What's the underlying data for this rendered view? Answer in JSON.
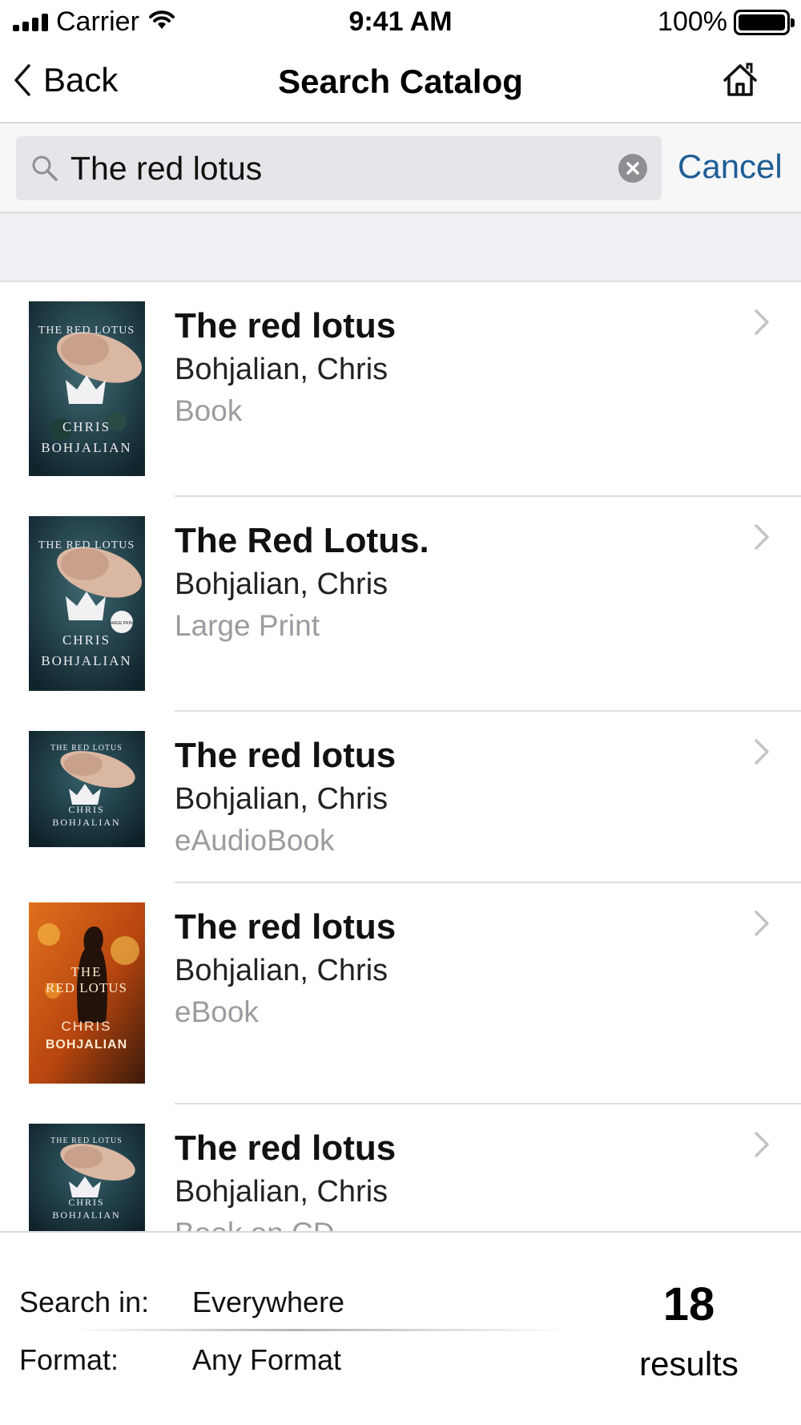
{
  "status_bar": {
    "carrier": "Carrier",
    "time": "9:41 AM",
    "battery": "100%"
  },
  "nav": {
    "back_label": "Back",
    "title": "Search Catalog",
    "home_icon": "home-icon"
  },
  "search": {
    "query": "The red lotus",
    "cancel_label": "Cancel"
  },
  "results": [
    {
      "title": "The red lotus",
      "author": "Bohjalian, Chris",
      "format": "Book"
    },
    {
      "title": "The Red Lotus.",
      "author": "Bohjalian, Chris",
      "format": "Large Print"
    },
    {
      "title": "The red lotus",
      "author": "Bohjalian, Chris",
      "format": "eAudioBook"
    },
    {
      "title": "The red lotus",
      "author": "Bohjalian, Chris",
      "format": "eBook"
    },
    {
      "title": "The red lotus",
      "author": "Bohjalian, Chris",
      "format": "Book on CD"
    }
  ],
  "covers": [
    {
      "top_text": "THE RED LOTUS",
      "author_first": "CHRIS",
      "author_last": "BOHJALIAN"
    },
    {
      "top_text": "THE RED LOTUS",
      "author_first": "CHRIS",
      "author_last": "BOHJALIAN",
      "badge": "LARGE PRINT"
    },
    {
      "top_text": "THE RED LOTUS",
      "author_first": "CHRIS",
      "author_last": "BOHJALIAN"
    },
    {
      "title_line1": "THE",
      "title_line2": "RED LOTUS",
      "author_first": "CHRIS",
      "author_last": "BOHJALIAN"
    },
    {
      "top_text": "THE RED LOTUS",
      "author_first": "CHRIS",
      "author_last": "BOHJALIAN"
    }
  ],
  "footer": {
    "search_in_label": "Search in:",
    "search_in_value": "Everywhere",
    "format_label": "Format:",
    "format_value": "Any Format",
    "result_count": "18",
    "result_label": "results"
  },
  "colors": {
    "accent": "#1f5e96",
    "secondary_text": "#9b9ba0",
    "background_band": "#efeff4"
  }
}
